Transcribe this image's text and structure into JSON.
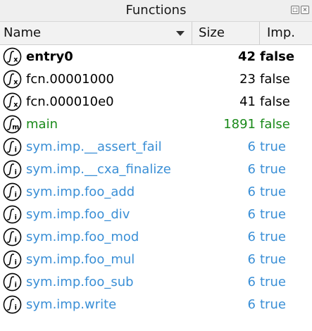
{
  "panel": {
    "title": "Functions"
  },
  "columns": {
    "name": "Name",
    "size": "Size",
    "imp": "Imp."
  },
  "colors": {
    "normal": "#000000",
    "main": "#1a8a1a",
    "import": "#3a8fd6"
  },
  "rows": [
    {
      "name": "entry0",
      "size": "42",
      "imp": "false",
      "icon": "function-x-icon",
      "style": "bold"
    },
    {
      "name": "fcn.00001000",
      "size": "23",
      "imp": "false",
      "icon": "function-x-icon",
      "style": "normal"
    },
    {
      "name": "fcn.000010e0",
      "size": "41",
      "imp": "false",
      "icon": "function-x-icon",
      "style": "normal"
    },
    {
      "name": "main",
      "size": "1891",
      "imp": "false",
      "icon": "function-m-icon",
      "style": "main"
    },
    {
      "name": "sym.imp.__assert_fail",
      "size": "6",
      "imp": "true",
      "icon": "function-i-icon",
      "style": "import"
    },
    {
      "name": "sym.imp.__cxa_finalize",
      "size": "6",
      "imp": "true",
      "icon": "function-i-icon",
      "style": "import"
    },
    {
      "name": "sym.imp.foo_add",
      "size": "6",
      "imp": "true",
      "icon": "function-i-icon",
      "style": "import"
    },
    {
      "name": "sym.imp.foo_div",
      "size": "6",
      "imp": "true",
      "icon": "function-i-icon",
      "style": "import"
    },
    {
      "name": "sym.imp.foo_mod",
      "size": "6",
      "imp": "true",
      "icon": "function-i-icon",
      "style": "import"
    },
    {
      "name": "sym.imp.foo_mul",
      "size": "6",
      "imp": "true",
      "icon": "function-i-icon",
      "style": "import"
    },
    {
      "name": "sym.imp.foo_sub",
      "size": "6",
      "imp": "true",
      "icon": "function-i-icon",
      "style": "import"
    },
    {
      "name": "sym.imp.write",
      "size": "6",
      "imp": "true",
      "icon": "function-i-icon",
      "style": "import"
    }
  ]
}
